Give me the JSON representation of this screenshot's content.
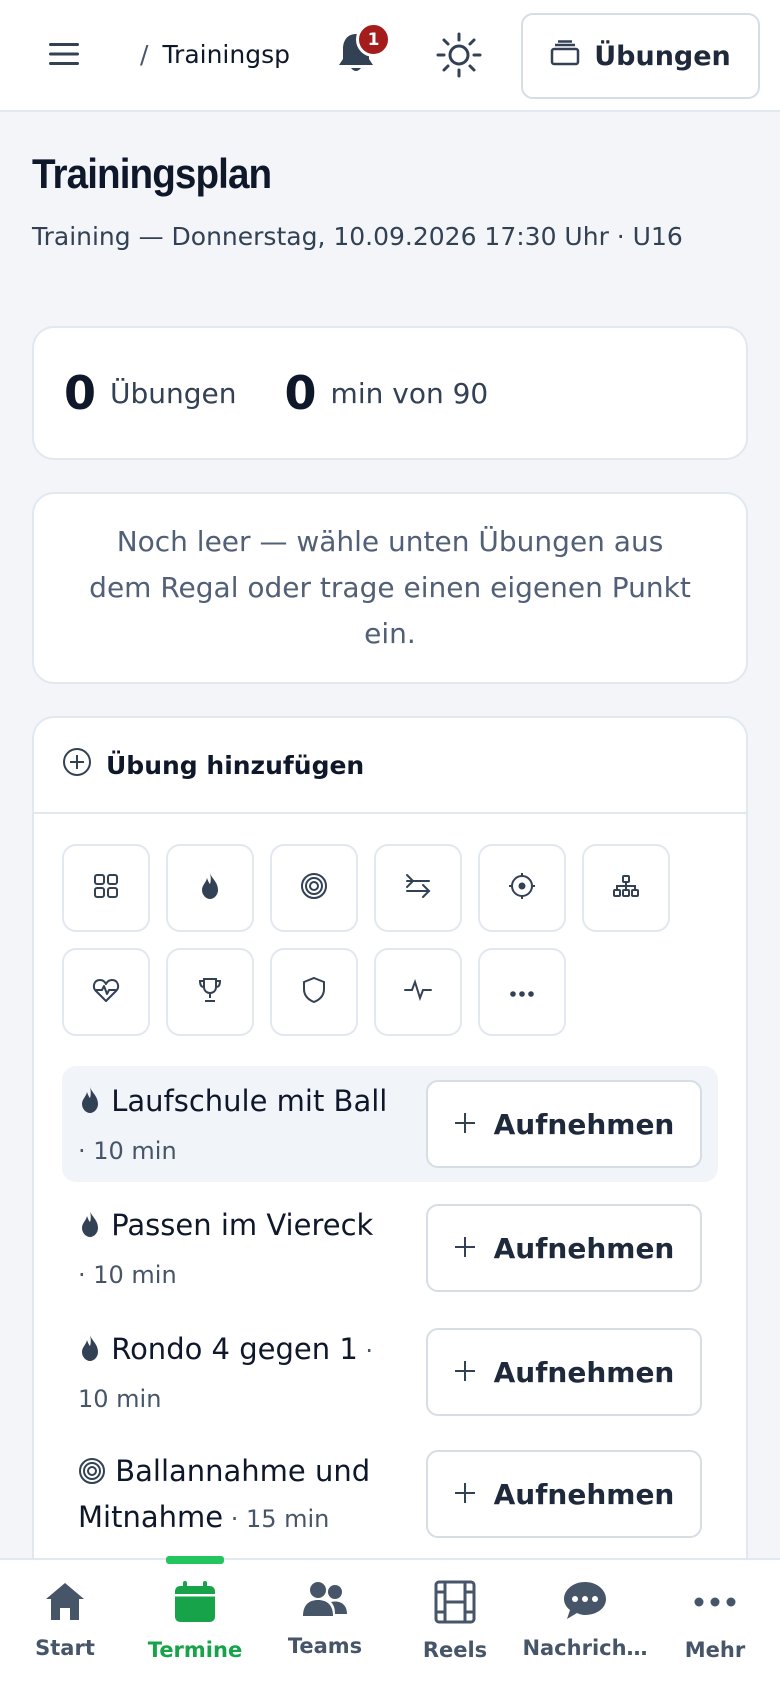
{
  "header": {
    "breadcrumb_sep": "/",
    "breadcrumb_current": "Trainingsp",
    "notification_count": "1",
    "exercises_button": "Übungen"
  },
  "page": {
    "title": "Trainingsplan",
    "subtitle": "Training — Donnerstag, 10.09.2026 17:30 Uhr · U16"
  },
  "stats": {
    "exercise_count": "0",
    "exercise_label": "Übungen",
    "minutes": "0",
    "minutes_label": "min von 90"
  },
  "empty_state": "Noch leer — wähle unten Übungen aus dem Regal oder trage einen eigenen Punkt ein.",
  "add_section": {
    "title": "Übung hinzufügen",
    "categories": [
      "grid-icon",
      "flame-icon",
      "target-icon",
      "arrows-icon",
      "crosshair-icon",
      "tree-icon",
      "heart-pulse-icon",
      "trophy-icon",
      "shield-icon",
      "activity-icon",
      "more-icon"
    ]
  },
  "exercises": [
    {
      "icon": "flame-icon",
      "name": "Laufschule mit Ball",
      "duration": " · 10 min",
      "button": "Aufnehmen"
    },
    {
      "icon": "flame-icon",
      "name": "Passen im Viereck",
      "duration": " · 10 min",
      "button": "Aufnehmen"
    },
    {
      "icon": "flame-icon",
      "name": "Rondo 4 gegen 1",
      "duration": " · 10 min",
      "button": "Aufnehmen"
    },
    {
      "icon": "target-icon",
      "name": "Ballannahme und Mitnahme",
      "duration": " · 15 min",
      "button": "Aufnehmen"
    }
  ],
  "nav": {
    "items": [
      "Start",
      "Termine",
      "Teams",
      "Reels",
      "Nachrich…",
      "Mehr"
    ],
    "active": "Termine",
    "active_color": "#16a34a"
  }
}
